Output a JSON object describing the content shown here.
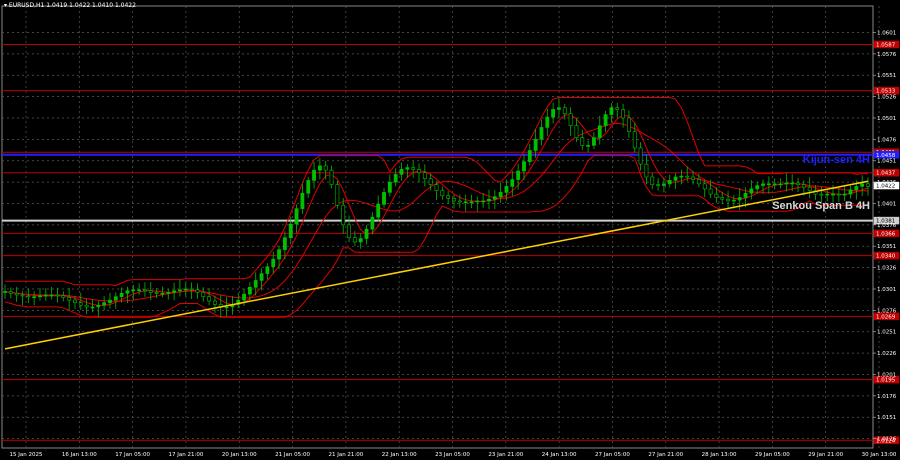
{
  "window": {
    "symbol_label": "▾ EURUSD,H1  1.0419 1.0422 1.0410 1.0422"
  },
  "colors": {
    "background": "#000000",
    "grid": "#5a5a5a",
    "candle": "#00c000",
    "ichimoku": "#e00000",
    "horizontal_levels": "#c00000",
    "kijun": "#2020ff",
    "senkou": "#d0d0d0",
    "trendline": "#ffd000",
    "axis_text": "#ffffff"
  },
  "annotations": {
    "kijun_label": "Kijun-sen 4H",
    "senkou_label": "Senkou Span B 4H"
  },
  "chart_data": {
    "type": "candlestick",
    "symbol": "EURUSD",
    "timeframe": "H1",
    "ohlc_header": {
      "open": 1.0419,
      "high": 1.0422,
      "low": 1.041,
      "close": 1.0422
    },
    "last_price": 1.0422,
    "ylim": [
      1.0115,
      1.0632
    ],
    "y_ticks": [
      1.0601,
      1.0576,
      1.0551,
      1.0526,
      1.0501,
      1.0476,
      1.0451,
      1.0426,
      1.0401,
      1.0376,
      1.0351,
      1.0326,
      1.0301,
      1.0276,
      1.0251,
      1.0226,
      1.0201,
      1.0176,
      1.0151,
      1.0126
    ],
    "x_ticks": [
      "15 Jan 2025",
      "16 Jan 13:00",
      "17 Jan 05:00",
      "17 Jan 21:00",
      "20 Jan 13:00",
      "21 Jan 05:00",
      "21 Jan 21:00",
      "22 Jan 13:00",
      "23 Jan 05:00",
      "23 Jan 21:00",
      "24 Jan 13:00",
      "27 Jan 05:00",
      "27 Jan 21:00",
      "28 Jan 13:00",
      "29 Jan 05:00",
      "29 Jan 21:00",
      "30 Jan 13:00"
    ],
    "horizontal_levels": [
      {
        "value": 1.0587,
        "label": "1.0587"
      },
      {
        "value": 1.0533,
        "label": "1.0533"
      },
      {
        "value": 1.0461,
        "label": "1.0461"
      },
      {
        "value": 1.0437,
        "label": "1.0437"
      },
      {
        "value": 1.0366,
        "label": "1.0366"
      },
      {
        "value": 1.034,
        "label": "1.0340"
      },
      {
        "value": 1.0269,
        "label": "1.0269"
      },
      {
        "value": 1.0195,
        "label": "1.0195"
      },
      {
        "value": 1.0124,
        "label": "1.0124"
      }
    ],
    "kijun_sen_4h": {
      "value": 1.0458,
      "label": "1.0458"
    },
    "senkou_span_b_4h": {
      "value": 1.0381,
      "label": "1.0381"
    },
    "trendline": {
      "from": {
        "x": 0,
        "y": 1.0231
      },
      "to": {
        "x": 148,
        "y": 1.0427
      }
    },
    "close_series": [
      1.0298,
      1.0296,
      1.0294,
      1.0293,
      1.0292,
      1.0292,
      1.0293,
      1.0294,
      1.0294,
      1.0293,
      1.0291,
      1.0288,
      1.0285,
      1.0282,
      1.028,
      1.028,
      1.0282,
      1.0285,
      1.0288,
      1.0292,
      1.0296,
      1.0299,
      1.03,
      1.03,
      1.0299,
      1.0297,
      1.0296,
      1.0296,
      1.0297,
      1.0299,
      1.03,
      1.0301,
      1.03,
      1.0297,
      1.0292,
      1.0287,
      1.0283,
      1.028,
      1.028,
      1.0283,
      1.0288,
      1.0295,
      1.0303,
      1.0311,
      1.0319,
      1.0327,
      1.0336,
      1.0347,
      1.0361,
      1.0377,
      1.0395,
      1.0413,
      1.0428,
      1.044,
      1.0445,
      1.044,
      1.0423,
      1.0399,
      1.0376,
      1.0361,
      1.0356,
      1.036,
      1.0371,
      1.0385,
      1.04,
      1.0414,
      1.0426,
      1.0435,
      1.0441,
      1.0443,
      1.0441,
      1.0437,
      1.043,
      1.0423,
      1.0416,
      1.041,
      1.0407,
      1.0404,
      1.0403,
      1.0403,
      1.0403,
      1.0404,
      1.0404,
      1.0406,
      1.0409,
      1.0414,
      1.0421,
      1.0429,
      1.0439,
      1.045,
      1.0463,
      1.0476,
      1.049,
      1.0502,
      1.0511,
      1.0513,
      1.0506,
      1.0492,
      1.0478,
      1.0469,
      1.0469,
      1.0478,
      1.0492,
      1.0505,
      1.0513,
      1.0511,
      1.0501,
      1.0485,
      1.0466,
      1.0447,
      1.0432,
      1.0423,
      1.0422,
      1.0424,
      1.0428,
      1.0432,
      1.0433,
      1.0432,
      1.0429,
      1.0424,
      1.0418,
      1.0412,
      1.0408,
      1.0406,
      1.0404,
      1.0405,
      1.0408,
      1.0413,
      1.0418,
      1.0422,
      1.0424,
      1.0424,
      1.0424,
      1.0424,
      1.0425,
      1.0425,
      1.0423,
      1.042,
      1.0416,
      1.0412,
      1.0411,
      1.0412,
      1.0412,
      1.0411,
      1.0412,
      1.0417,
      1.0421,
      1.0424,
      1.0421
    ],
    "ichimoku_lines_note": "Red Ichimoku / envelope lines follow the price series"
  }
}
